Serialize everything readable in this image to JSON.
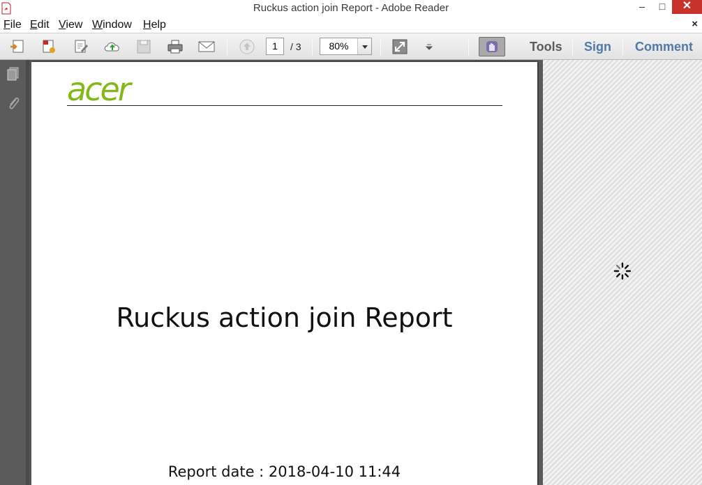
{
  "window": {
    "title": "Ruckus action join Report - Adobe Reader",
    "minimize_glyph": "–",
    "maximize_glyph": "□",
    "close_glyph": "✕"
  },
  "menu": {
    "items": [
      {
        "label": "File"
      },
      {
        "label": "Edit"
      },
      {
        "label": "View"
      },
      {
        "label": "Window"
      },
      {
        "label": "Help"
      }
    ],
    "close_glyph": "×"
  },
  "toolbar": {
    "buttons": [
      "open-icon",
      "create-pdf-icon",
      "edit-icon",
      "cloud-upload-icon",
      "save-icon",
      "print-icon",
      "email-icon",
      "page-up-icon",
      "fit-page-icon",
      "more-tools-icon",
      "hand-tool-icon"
    ],
    "page_current": "1",
    "page_total": "/ 3",
    "zoom_value": "80%",
    "tools_label": "Tools",
    "sign_label": "Sign",
    "comment_label": "Comment",
    "accent_color": "#4f79a8"
  },
  "navpane": {
    "icons": [
      "pages-icon",
      "attachments-icon"
    ]
  },
  "document": {
    "logo_text": "acer",
    "logo_color": "#83b81a",
    "title": "Ruckus action join Report",
    "report_date": "Report date : 2018-04-10 11:44"
  },
  "status": {
    "loading_icon": "spinner-icon"
  }
}
